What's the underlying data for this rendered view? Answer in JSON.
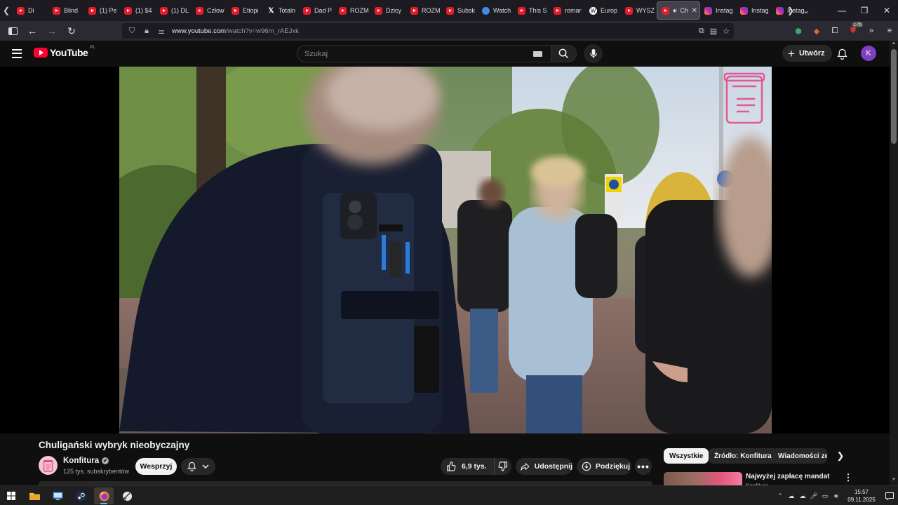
{
  "browser": {
    "tabs": [
      {
        "icon": "youtube",
        "title": "Di"
      },
      {
        "icon": "youtube",
        "title": "Blind"
      },
      {
        "icon": "youtube",
        "title": "(1) Pe"
      },
      {
        "icon": "youtube",
        "title": "(1) $4"
      },
      {
        "icon": "youtube",
        "title": "(1) DL"
      },
      {
        "icon": "youtube",
        "title": "Człow"
      },
      {
        "icon": "youtube",
        "title": "Etiopi"
      },
      {
        "icon": "x",
        "title": "Totaln"
      },
      {
        "icon": "youtube",
        "title": "Dad P"
      },
      {
        "icon": "youtube",
        "title": "ROZM"
      },
      {
        "icon": "youtube",
        "title": "Dzicy"
      },
      {
        "icon": "youtube",
        "title": "ROZM"
      },
      {
        "icon": "youtube",
        "title": "Subsk"
      },
      {
        "icon": "globe",
        "title": "Watch"
      },
      {
        "icon": "youtube",
        "title": "This S"
      },
      {
        "icon": "youtube",
        "title": "romar"
      },
      {
        "icon": "wiki",
        "title": "Europ"
      },
      {
        "icon": "youtube",
        "title": "WYSZ"
      },
      {
        "icon": "youtube",
        "title": "Ch",
        "active": true,
        "audio": true
      },
      {
        "icon": "instagram",
        "title": "Instag"
      },
      {
        "icon": "instagram",
        "title": "Instag"
      },
      {
        "icon": "instagram",
        "title": "Instag"
      }
    ],
    "url": {
      "host": "www.youtube.com",
      "path": "/watch?v=w96m_rAEJxk"
    },
    "extension_badge": "176"
  },
  "youtube": {
    "logo_text": "YouTube",
    "country_code": "PL",
    "search_placeholder": "Szukaj",
    "create_label": "Utwórz",
    "avatar_letter": "K"
  },
  "video": {
    "title": "Chuligański wybryk nieobyczajny",
    "channel": {
      "name": "Konfitura",
      "subscribers": "125 tys. subskrybentów"
    },
    "support_label": "Wesprzyj",
    "likes": "6,9 tys.",
    "share_label": "Udostępnij",
    "thanks_label": "Podziękuj"
  },
  "sidebar": {
    "chips": [
      "Wszystkie",
      "Źródło: Konfitura",
      "Wiadomości ze"
    ],
    "recommendation": {
      "title": "Najwyżej zapłacę mandat",
      "channel": "Konfitura"
    }
  },
  "taskbar": {
    "time": "15:57",
    "date": "09.11.2025"
  },
  "colors": {
    "youtube_red": "#ff0033",
    "background": "#0f0f0f",
    "avatar": "#7f3fbf"
  }
}
